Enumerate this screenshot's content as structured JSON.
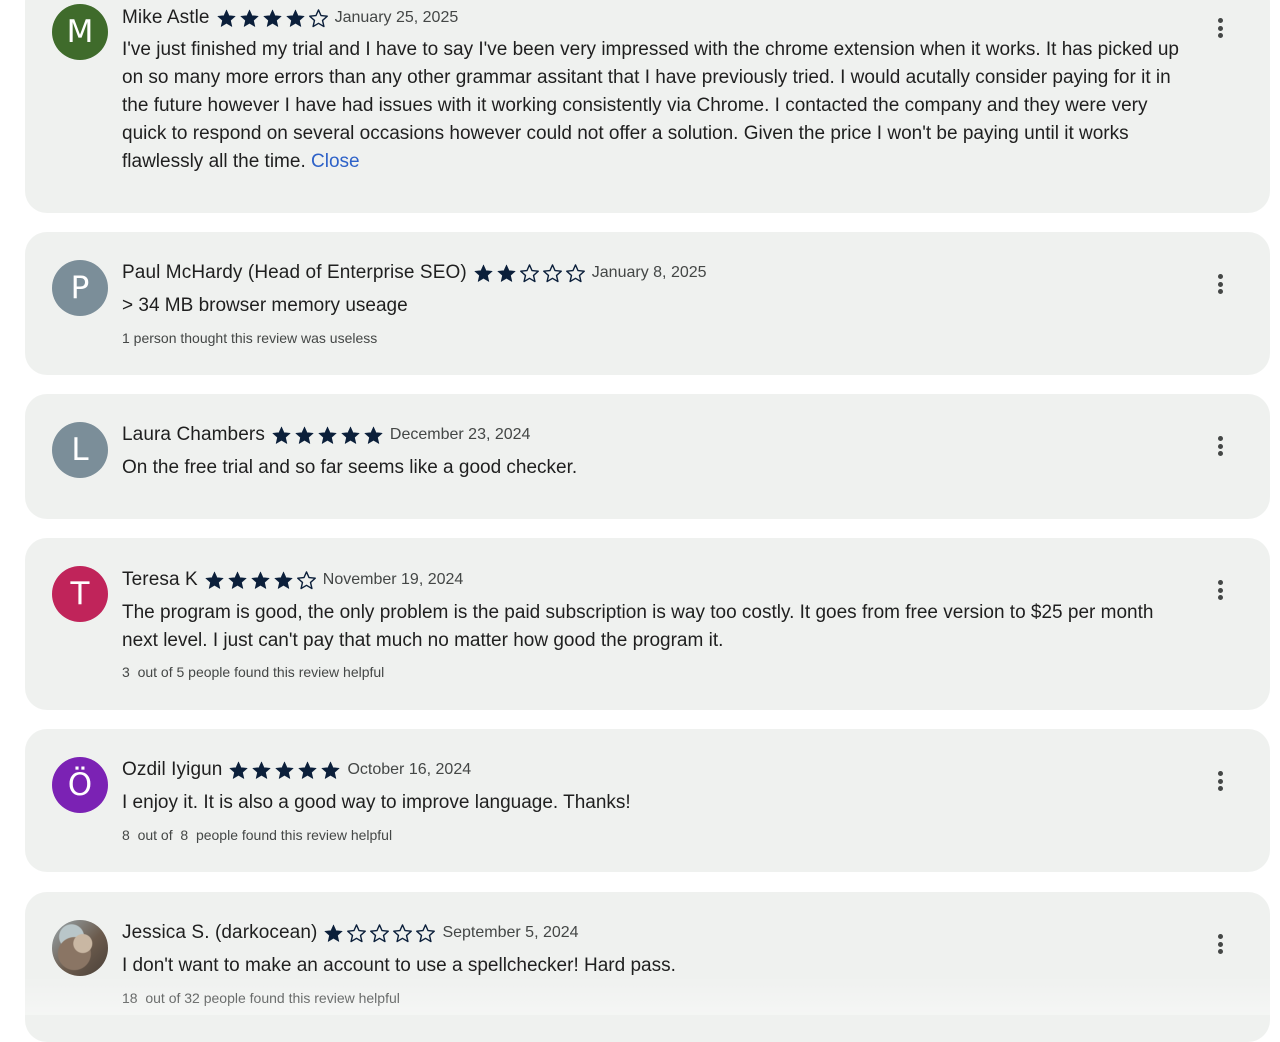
{
  "colors": {
    "card_bg": "#eff1ef",
    "star_fill": "#0b1f3a",
    "link": "#2e62c8",
    "avatar_m": "#3f6b2b",
    "avatar_p": "#7b8e99",
    "avatar_l": "#7b8e99",
    "avatar_t": "#c0245a",
    "avatar_o": "#7b22b4"
  },
  "reviews": [
    {
      "avatar_letter": "M",
      "name": "Mike Astle",
      "rating": 4,
      "date": "January 25, 2025",
      "text": "I've just finished my trial and I have to say I've been very impressed with the chrome extension when it works. It has picked up on so many more errors than any other grammar assitant that I have previously tried. I would acutally consider paying for it in the future however I have had issues with it working consistently via Chrome. I contacted the company and they were very quick to respond on several occasions however could not offer a solution. Given the price I won't be paying until it works flawlessly all the time.",
      "close_label": "Close",
      "more_icon": "more-vert-icon"
    },
    {
      "avatar_letter": "P",
      "name": "Paul McHardy (Head of Enterprise SEO)",
      "rating": 2,
      "date": "January 8, 2025",
      "text": "> 34 MB browser memory useage",
      "helpful": "1 person thought this review was useless"
    },
    {
      "avatar_letter": "L",
      "name": "Laura Chambers",
      "rating": 5,
      "date": "December 23, 2024",
      "text": "On the free trial and so far seems like a good checker."
    },
    {
      "avatar_letter": "T",
      "name": "Teresa K",
      "rating": 4,
      "date": "November 19, 2024",
      "text": "The program is good, the only problem is the paid subscription is way too costly. It goes from free version to $25 per month next level. I just can't pay that much no matter how good the program it.",
      "helpful": "3  out of 5 people found this review helpful"
    },
    {
      "avatar_letter": "Ö",
      "name": "Ozdil Iyigun",
      "rating": 5,
      "date": "October 16, 2024",
      "text": "I enjoy it.  It is  also a good way to improve language.  Thanks!",
      "helpful": "8  out of  8  people found this review helpful"
    },
    {
      "avatar_letter": "",
      "name": "Jessica S. (darkocean)",
      "rating": 1,
      "date": "September 5, 2024",
      "text": "I don't want to make an account to use a spellchecker! Hard pass.",
      "helpful": "18  out of 32 people found this review helpful"
    }
  ]
}
